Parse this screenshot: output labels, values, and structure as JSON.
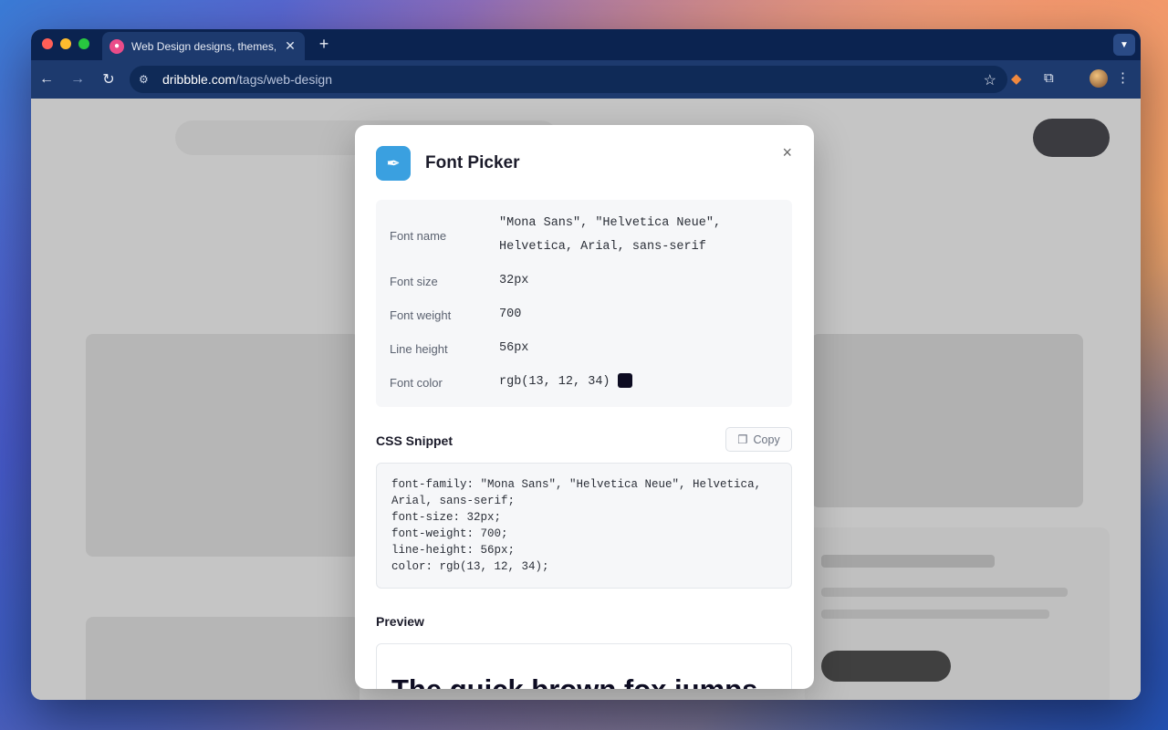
{
  "browser": {
    "tab_title": "Web Design designs, themes,",
    "tab_close": "✕",
    "new_tab": "+",
    "url_domain": "dribbble.com",
    "url_path": "/tags/web-design"
  },
  "modal": {
    "title": "Font Picker",
    "close": "×",
    "properties": [
      {
        "label": "Font name",
        "value": "\"Mona Sans\", \"Helvetica Neue\",",
        "value2": "Helvetica, Arial, sans-serif"
      },
      {
        "label": "Font size",
        "value": "32px"
      },
      {
        "label": "Font weight",
        "value": "700"
      },
      {
        "label": "Line height",
        "value": "56px"
      },
      {
        "label": "Font color",
        "value": "rgb(13, 12, 34)",
        "swatch": "#0d0c22"
      }
    ],
    "css_snippet_label": "CSS Snippet",
    "copy_label": "Copy",
    "snippet_lines": [
      "font-family: \"Mona Sans\", \"Helvetica Neue\", Helvetica,",
      "Arial, sans-serif;",
      "font-size: 32px;",
      "font-weight: 700;",
      "line-height: 56px;",
      "color: rgb(13, 12, 34);"
    ],
    "preview_label": "Preview",
    "preview_text": "The quick brown fox jumps"
  },
  "colors": {
    "accent": "#3aa0e0",
    "font_color": "#0d0c22"
  }
}
